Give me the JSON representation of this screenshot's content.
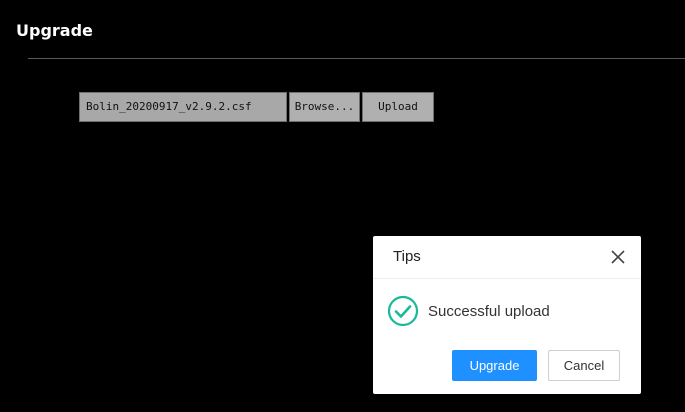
{
  "header": {
    "title": "Upgrade"
  },
  "file_upload": {
    "file_name": "Bolin_20200917_v2.9.2.csf",
    "browse_label": "Browse...",
    "upload_label": "Upload"
  },
  "dialog": {
    "title": "Tips",
    "close_icon": "close-icon",
    "status_icon": "check-circle-icon",
    "message": "Successful upload",
    "primary_label": "Upgrade",
    "cancel_label": "Cancel"
  },
  "colors": {
    "background": "#000000",
    "accent": "#1e90ff",
    "success": "#19b99a"
  }
}
